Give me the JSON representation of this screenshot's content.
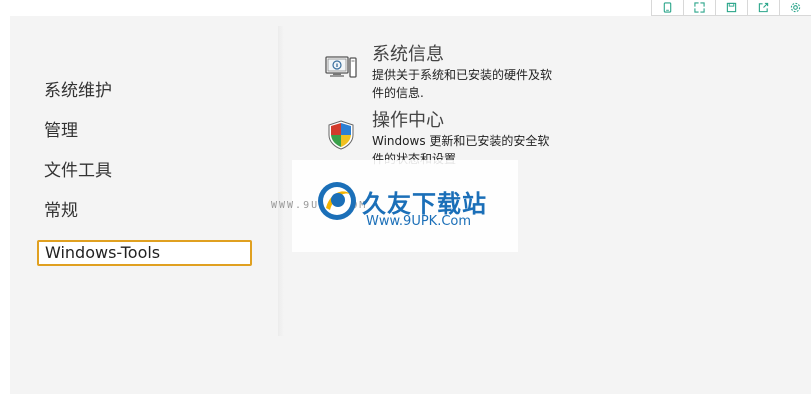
{
  "sidebar": {
    "items": [
      {
        "label": "系统维护"
      },
      {
        "label": "管理"
      },
      {
        "label": "文件工具"
      },
      {
        "label": "常规"
      },
      {
        "label": "Windows-Tools",
        "selected": true
      }
    ]
  },
  "content": {
    "entries": [
      {
        "title": "系统信息",
        "desc": "提供关于系统和已安装的硬件及软件的信息.",
        "icon": "computer-info-icon"
      },
      {
        "title": "操作中心",
        "desc": "Windows 更新和已安装的安全软件的状态和设置",
        "icon": "security-shield-icon"
      }
    ]
  },
  "toolbar": {
    "icons": [
      "tablet-icon",
      "expand-icon",
      "save-icon",
      "export-icon",
      "settings-icon"
    ]
  },
  "watermark": {
    "small": "WWW.9UPK.COM",
    "title": "久友下载站",
    "url": "Www.9UPK.Com"
  },
  "colors": {
    "toolbar_icon": "#2aa58a",
    "selected_border": "#e0a020",
    "watermark_blue": "#1b6fb8"
  }
}
